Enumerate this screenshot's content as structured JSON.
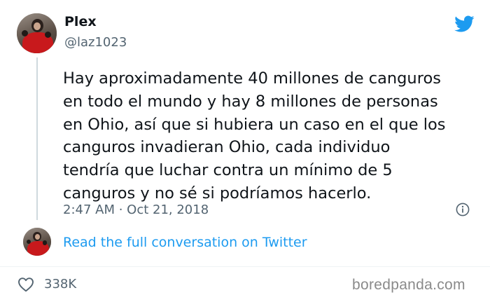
{
  "tweet": {
    "author_name": "Plex",
    "handle": "@laz1023",
    "text": "Hay aproximadamente 40 millones de canguros\nen todo el mundo y hay 8 millones de personas\nen Ohio, así que si hubiera un caso en el que los\ncanguros invadieran Ohio, cada individuo\ntendría que luchar contra un mínimo de 5\ncanguros y no sé si podríamos hacerlo.",
    "timestamp": "2:47 AM · Oct 21, 2018",
    "read_more_label": "Read the full conversation on Twitter",
    "like_count": "338K"
  },
  "watermark": "boredpanda.com",
  "colors": {
    "twitter_blue": "#1d9bf0",
    "text_primary": "#0f1419",
    "text_secondary": "#536471"
  },
  "icons": [
    "twitter-bird-icon",
    "info-icon",
    "heart-icon"
  ]
}
